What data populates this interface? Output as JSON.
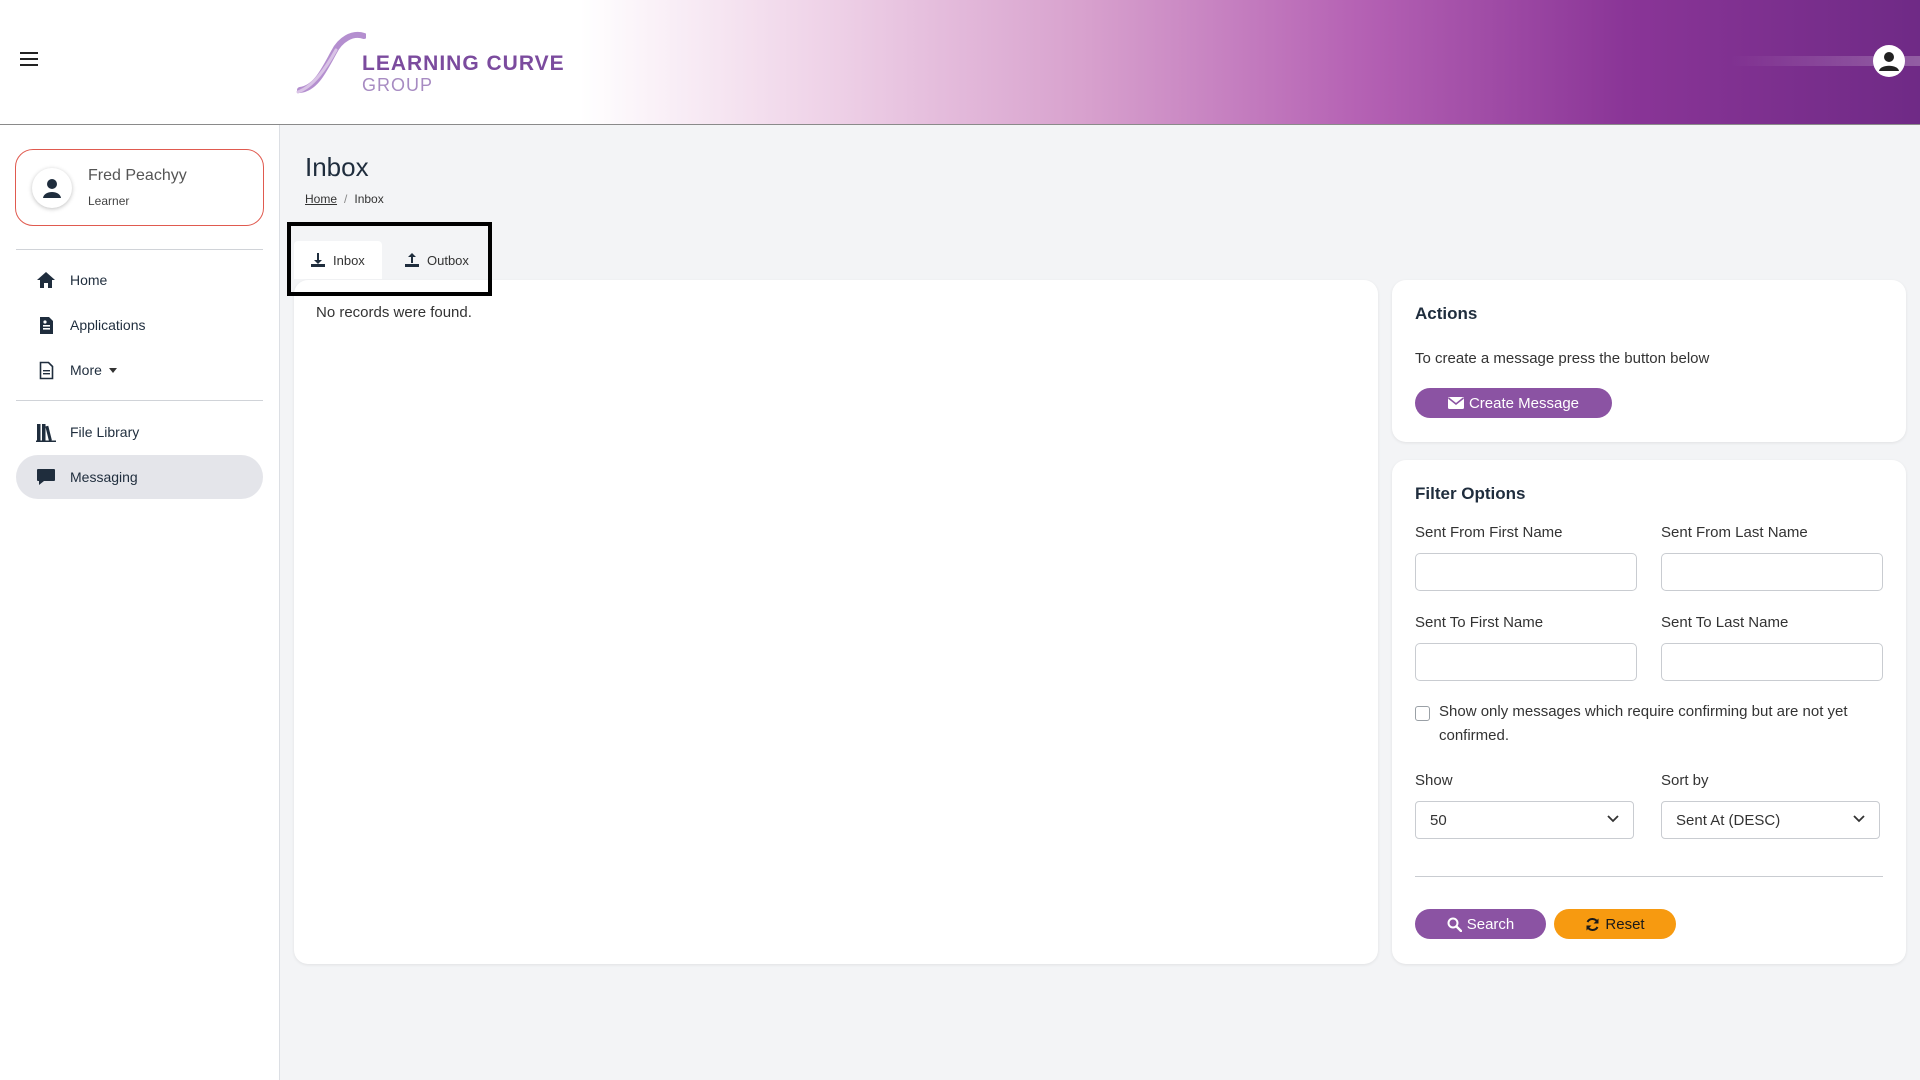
{
  "header": {
    "brand_line1": "LEARNING CURVE",
    "brand_line2": "GROUP",
    "menu_icon": "hamburger-icon",
    "user_icon": "user-circle-icon",
    "brand_colors": {
      "primary": "#7b4b9e",
      "banner_end": "#6f2a86"
    }
  },
  "sidebar": {
    "user": {
      "name": "Fred Peachyy",
      "role": "Learner"
    },
    "items": [
      {
        "label": "Home",
        "icon": "home-icon"
      },
      {
        "label": "Applications",
        "icon": "document-icon"
      },
      {
        "label": "More",
        "icon": "file-icon"
      },
      {
        "label": "File Library",
        "icon": "library-icon"
      },
      {
        "label": "Messaging",
        "icon": "message-icon",
        "active": true
      }
    ]
  },
  "page": {
    "title": "Inbox",
    "breadcrumb": {
      "home": "Home",
      "current": "Inbox"
    }
  },
  "tabs": [
    {
      "label": "Inbox",
      "icon": "download-icon",
      "active": true
    },
    {
      "label": "Outbox",
      "icon": "upload-icon",
      "active": false
    }
  ],
  "records": {
    "empty_text": "No records were found."
  },
  "actions": {
    "title": "Actions",
    "description": "To create a message press the button below",
    "create_button": "Create Message"
  },
  "filters": {
    "title": "Filter Options",
    "sent_from_first_label": "Sent From First Name",
    "sent_from_first_value": "",
    "sent_from_last_label": "Sent From Last Name",
    "sent_from_last_value": "",
    "sent_to_first_label": "Sent To First Name",
    "sent_to_first_value": "",
    "sent_to_last_label": "Sent To Last Name",
    "sent_to_last_value": "",
    "confirm_line1": "Show only messages which require confirming but are not yet",
    "confirm_line2": "confirmed.",
    "confirm_checked": false,
    "show_label": "Show",
    "show_value": "50",
    "sort_label": "Sort by",
    "sort_value": "Sent At (DESC)",
    "search_button": "Search",
    "reset_button": "Reset"
  },
  "colors": {
    "accent": "#8b53a3",
    "warning": "#f79a10",
    "highlight_border": "#e05a4f"
  }
}
